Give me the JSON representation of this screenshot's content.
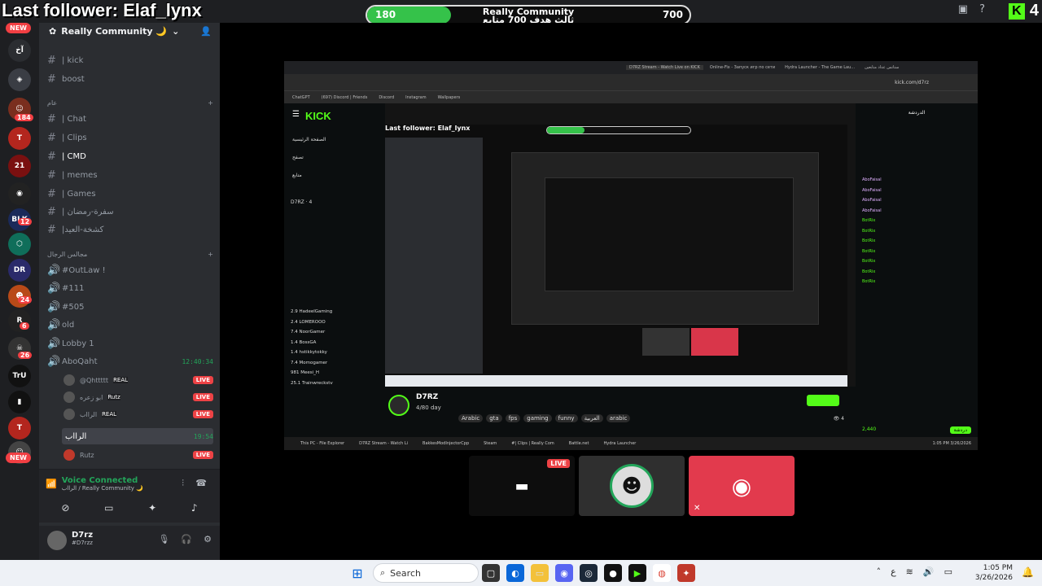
{
  "overlay": {
    "last_follower": "Last follower: Elaf_lynx",
    "goal_start": "180",
    "goal_end": "700",
    "goal_title": "Really Community",
    "goal_subtitle": "ثالث هدف 700 متابع",
    "goal_progress": 0.26,
    "kick_viewers": "4"
  },
  "rail": {
    "new_top": "NEW",
    "new_bottom": "NEW",
    "badges": [
      "184",
      "12",
      "24",
      "6",
      "26"
    ]
  },
  "sidebar": {
    "server_name": "Really Community 🌙",
    "channels_top": [
      "| kick",
      "boost"
    ],
    "category_1": "عام",
    "channels_mid": [
      "| Chat",
      "| Clips",
      "| CMD",
      "| memes",
      "| Games",
      "| سفرة-رمضان",
      "|كشخة-العيد"
    ],
    "category_2": "مجالس الرجال",
    "channels_voice": [
      "#OutLaw !",
      "#111",
      "#505",
      "old",
      "Lobby 1",
      "AboQaht"
    ],
    "aboqaht_time": "12:40:34",
    "aboqaht_users": [
      "@Qhttttt",
      "ابو زعره",
      "الرااب"
    ],
    "aboqaht_tags": [
      "REAL",
      "Rutz",
      "REAL"
    ],
    "live_label": "LIVE",
    "current_voice": "الرااب",
    "current_voice_time": "19:54",
    "current_voice_user": "Rutz"
  },
  "voice_panel": {
    "status": "Voice Connected",
    "location": "الرااب / Really Community 🌙"
  },
  "user_panel": {
    "name": "D7rz",
    "tag": "#D7rzz"
  },
  "embedded": {
    "tabs": [
      "D7RZ Stream - Watch Live on KICK",
      "Online-Fix - Запуск игр по сети",
      "Hydra Launcher - The Game Lau...",
      "ستاتس عداد متابعين"
    ],
    "url": "kick.com/d7rz",
    "bookmarks": [
      "ChatGPT",
      "(697) Discord | Friends",
      "Discord",
      "Instagram",
      "Wallpapers"
    ],
    "nav": [
      "الصفحة الرئيسية",
      "تصفح",
      "متابع"
    ],
    "following": [
      {
        "name": "D7RZ",
        "viewers": "4"
      },
      {
        "name": "HadeelGaming",
        "viewers": "2.9"
      },
      {
        "name": "LOMEROOO",
        "viewers": "2.4"
      },
      {
        "name": "NoorGamer",
        "viewers": "7.4"
      },
      {
        "name": "BossGA",
        "viewers": "1.4"
      },
      {
        "name": "hstikkytokky",
        "viewers": "1.4"
      },
      {
        "name": "Momogamer",
        "viewers": "7.4"
      },
      {
        "name": "Meesi_H",
        "viewers": "981"
      },
      {
        "name": "Trainwreckstv",
        "viewers": "25.1"
      }
    ],
    "streamer": "D7RZ",
    "stream_day": "4/80 day",
    "tags": [
      "Arabic",
      "gta",
      "fps",
      "gaming",
      "funny",
      "العربية",
      "arabic"
    ],
    "viewer_count": "4",
    "chat_header": "الدردشة",
    "chat_users": [
      "AboFaisal",
      "AboFaisal",
      "AboFaisal",
      "AboFaisal",
      "BotRix",
      "BotRix",
      "BotRix",
      "BotRix",
      "BotRix",
      "BotRix",
      "BotRix"
    ],
    "points": "2,440",
    "chat_button": "دردشة",
    "taskbar_items": [
      "This PC - File Explorer",
      "D7RZ Stream - Watch Li",
      "BakkesModInjectorCpp",
      "Steam",
      "#| Clips | Really Com",
      "Battle.net",
      "Hydra Launcher"
    ],
    "mini_clock_time": "1:05 PM",
    "mini_clock_date": "3/26/2026"
  },
  "tiles": {
    "live_label": "LIVE"
  },
  "taskbar": {
    "search_label": "Search",
    "time": "1:05 PM",
    "date": "3/26/2026"
  }
}
